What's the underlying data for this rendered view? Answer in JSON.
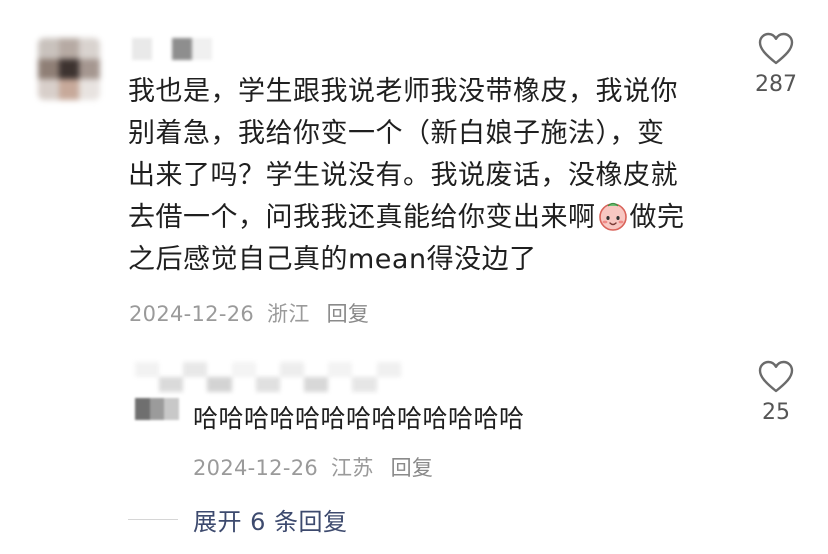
{
  "main_comment": {
    "text_before_emoji": "我也是，学生跟我说老师我没带橡皮，我说你\n别着急，我给你变一个（新白娘子施法），变\n出来了吗？学生说没有。我说废话，没橡皮就\n去借一个，问我我还真能给你变出来啊",
    "emoji": "smiling-face-emoji",
    "text_after_emoji": "做完\n之后感觉自己真的mean得没边了",
    "date": "2024-12-26",
    "region": "浙江",
    "reply_label": "回复",
    "like_count": "287"
  },
  "reply_comment": {
    "text": "哈哈哈哈哈哈哈哈哈哈哈哈哈",
    "date": "2024-12-26",
    "region": "江苏",
    "reply_label": "回复",
    "like_count": "25"
  },
  "expand": {
    "label": "展开 6 条回复"
  },
  "colors": {
    "text": "#1f1f1f",
    "meta": "#9a9a9a",
    "link": "#3d4a6e",
    "heart": "#6b6b6b"
  }
}
